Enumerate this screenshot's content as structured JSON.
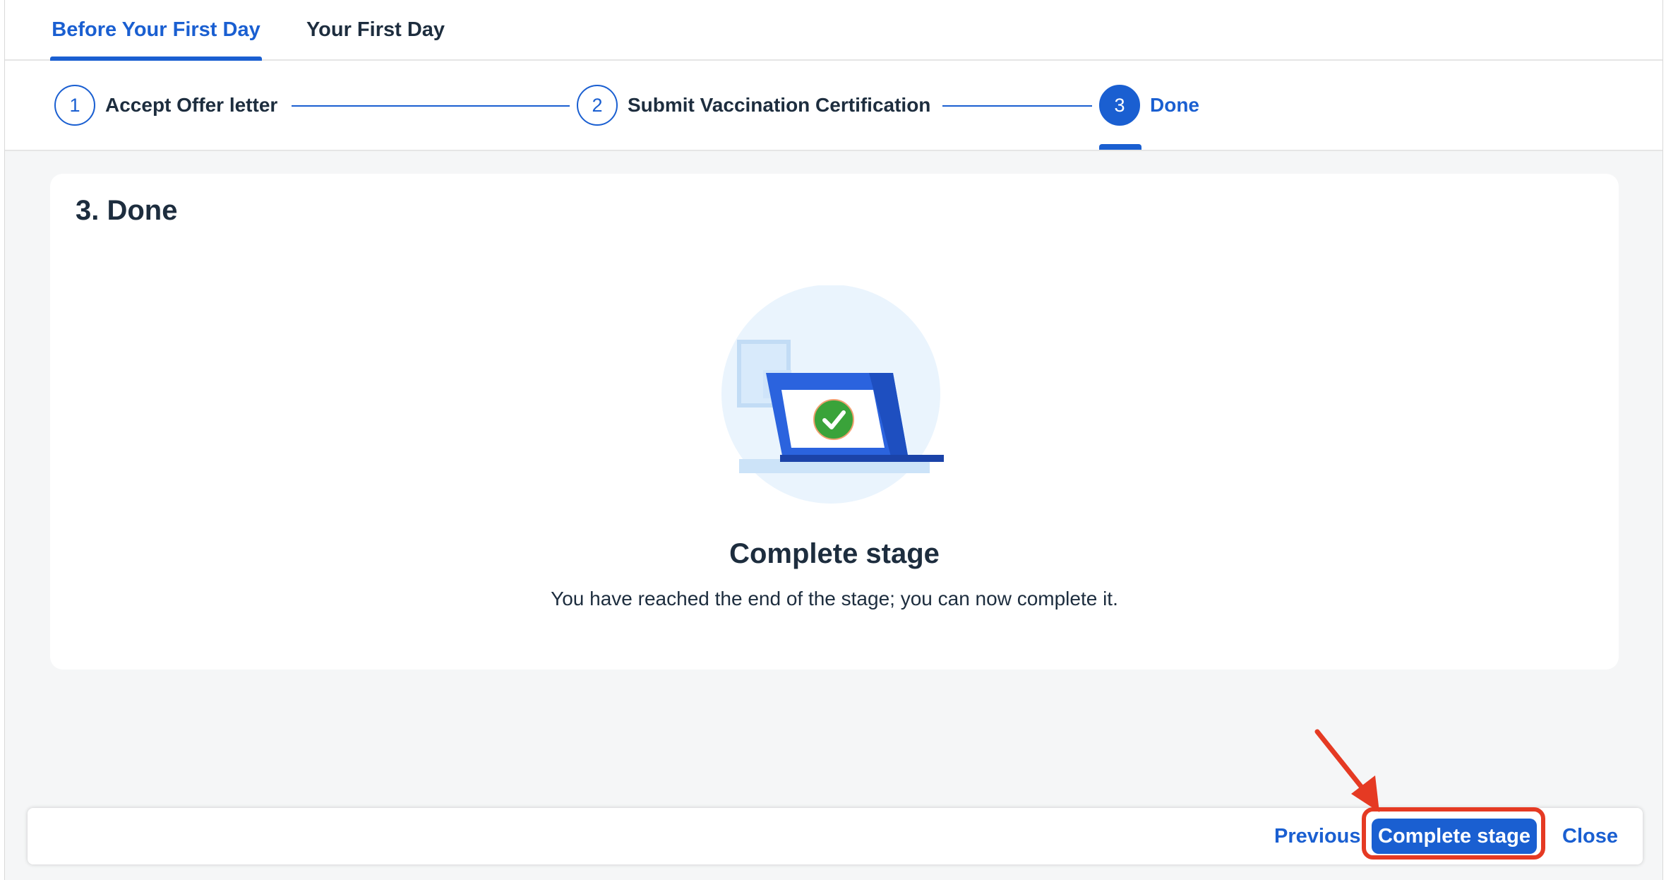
{
  "tabs": [
    {
      "label": "Before Your First Day",
      "active": true
    },
    {
      "label": "Your First Day",
      "active": false
    }
  ],
  "stepper": {
    "steps": [
      {
        "number": "1",
        "label": "Accept Offer letter",
        "active": false
      },
      {
        "number": "2",
        "label": "Submit Vaccination Certification",
        "active": false
      },
      {
        "number": "3",
        "label": "Done",
        "active": true
      }
    ]
  },
  "card": {
    "title": "3. Done",
    "heading": "Complete stage",
    "description": "You have reached the end of the stage; you can now complete it."
  },
  "footer": {
    "previous_label": "Previous",
    "complete_label": "Complete stage",
    "close_label": "Close"
  },
  "colors": {
    "accent": "#1a5fd1",
    "annotation": "#e53a23",
    "success": "#3aa33a"
  },
  "icons": {
    "illustration": "laptop-checkmark-illustration",
    "annotation_arrow": "red-arrow-icon"
  }
}
